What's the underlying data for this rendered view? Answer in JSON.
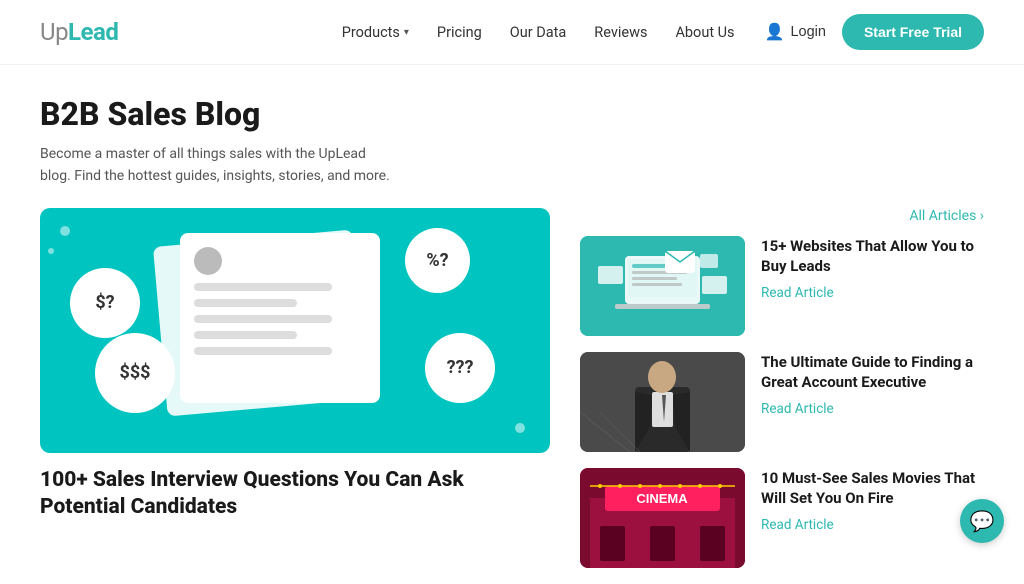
{
  "logo": {
    "part1": "Up",
    "part2": "Lead"
  },
  "nav": {
    "items": [
      {
        "label": "Products",
        "hasDropdown": true
      },
      {
        "label": "Pricing",
        "hasDropdown": false
      },
      {
        "label": "Our Data",
        "hasDropdown": false
      },
      {
        "label": "Reviews",
        "hasDropdown": false
      },
      {
        "label": "About Us",
        "hasDropdown": false
      }
    ]
  },
  "header": {
    "login_label": "Login",
    "cta_label": "Start Free Trial"
  },
  "blog": {
    "title": "B2B Sales Blog",
    "subtitle": "Become a master of all things sales with the UpLead blog. Find the hottest guides, insights, stories, and more.",
    "all_articles": "All Articles ›"
  },
  "featured": {
    "title": "100+ Sales Interview Questions You Can Ask Potential Candidates",
    "bubbles": [
      "$?",
      "%?",
      "$$$",
      "???"
    ]
  },
  "articles": [
    {
      "title": "15+ Websites That Allow You to Buy Leads",
      "read_label": "Read Article"
    },
    {
      "title": "The Ultimate Guide to Finding a Great Account Executive",
      "read_label": "Read Article"
    },
    {
      "title": "10 Must-See Sales Movies That Will Set You On Fire",
      "read_label": "Read Article"
    }
  ],
  "colors": {
    "teal": "#2db8b0",
    "dark": "#1a1a1a",
    "gray": "#555"
  }
}
